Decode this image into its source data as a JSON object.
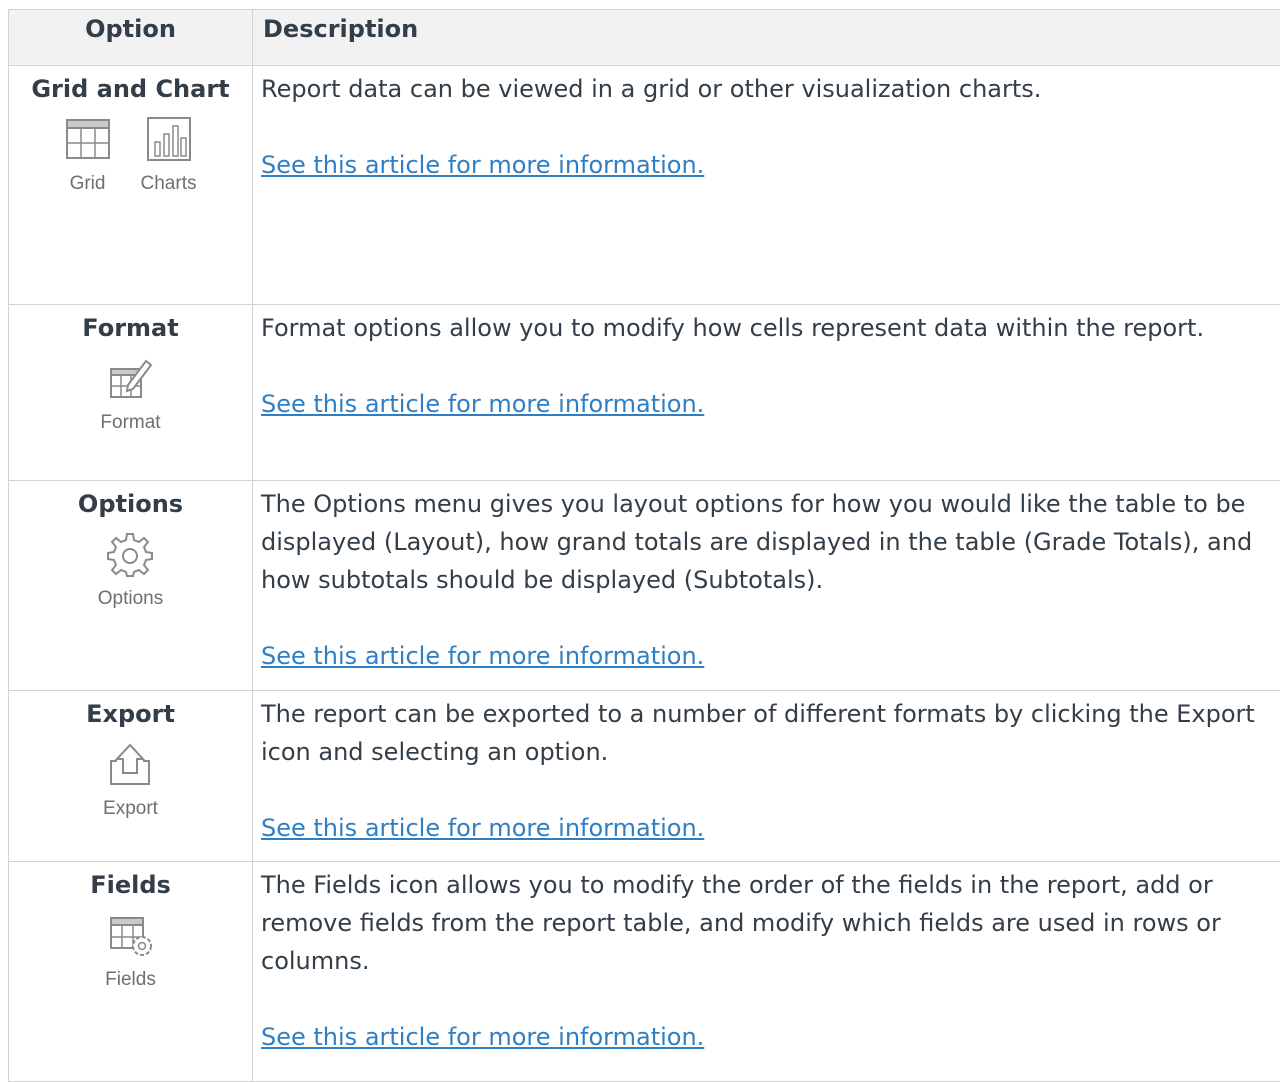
{
  "header": {
    "option": "Option",
    "description": "Description"
  },
  "rows": [
    {
      "option": "Grid and Chart",
      "icons": [
        {
          "name": "grid-icon",
          "label": "Grid"
        },
        {
          "name": "bar-chart-icon",
          "label": "Charts"
        }
      ],
      "description": [
        "Report data can be viewed in a grid or other visualization charts."
      ],
      "link": "See this article for more information."
    },
    {
      "option": "Format",
      "icons": [
        {
          "name": "format-icon",
          "label": "Format"
        }
      ],
      "description": [
        "Format options allow you to modify how cells represent data within the report."
      ],
      "link": "See this article for more information."
    },
    {
      "option": "Options",
      "icons": [
        {
          "name": "gear-icon",
          "label": "Options"
        }
      ],
      "description": [
        "The Options menu gives you layout options for how you would like the table to be displayed (Layout), how grand totals are displayed in the table (Grade Totals), and how subtotals should be displayed (Subtotals)."
      ],
      "link": "See this article for more information."
    },
    {
      "option": "Export",
      "icons": [
        {
          "name": "export-icon",
          "label": "Export"
        }
      ],
      "description": [
        "The report can be exported to a number of different formats by clicking the Export icon and selecting an option."
      ],
      "link": "See this article for more information."
    },
    {
      "option": "Fields",
      "icons": [
        {
          "name": "fields-icon",
          "label": "Fields"
        }
      ],
      "description": [
        "The Fields icon allows you to modify the order of the fields in the report, add or remove fields from the report table, and modify which fields are used in rows or columns."
      ],
      "link": "See this article for more information."
    }
  ],
  "colors": {
    "link": "#2f7fc4",
    "text": "#333e48",
    "header_bg": "#f2f2f2",
    "border": "#cfd3d6"
  }
}
